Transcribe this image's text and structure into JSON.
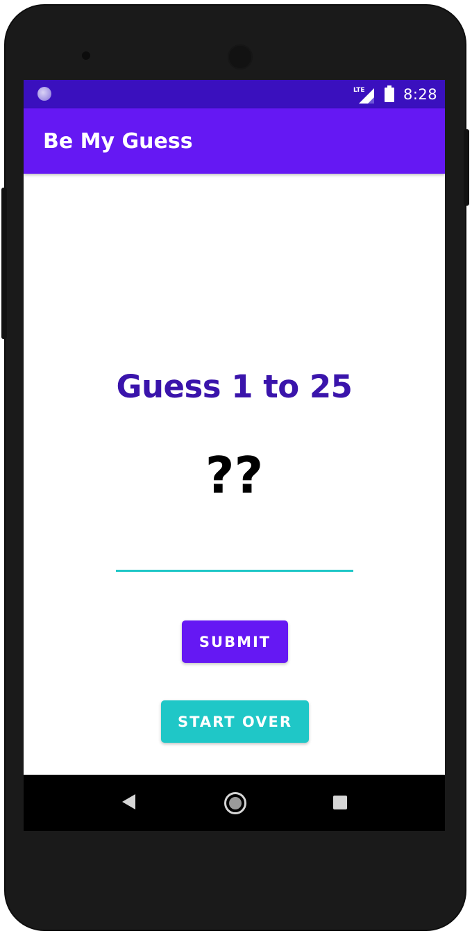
{
  "status_bar": {
    "time": "8:28",
    "network_label": "LTE",
    "icons": [
      "notification-dot-icon",
      "signal-icon",
      "battery-icon"
    ]
  },
  "app_bar": {
    "title": "Be My Guess"
  },
  "main": {
    "heading": "Guess 1 to 25",
    "mystery_number": "??",
    "guess_input": {
      "value": "",
      "placeholder": ""
    },
    "submit_label": "SUBMIT",
    "start_over_label": "START OVER"
  },
  "nav_bar": {
    "icons": [
      "back-icon",
      "home-icon",
      "recent-apps-icon"
    ]
  },
  "colors": {
    "status_bar": "#3a10be",
    "app_bar": "#6518f3",
    "heading_text": "#3a14ab",
    "submit_button": "#6518f3",
    "start_over_button": "#1fc7c7",
    "input_underline": "#1fc7c7"
  }
}
